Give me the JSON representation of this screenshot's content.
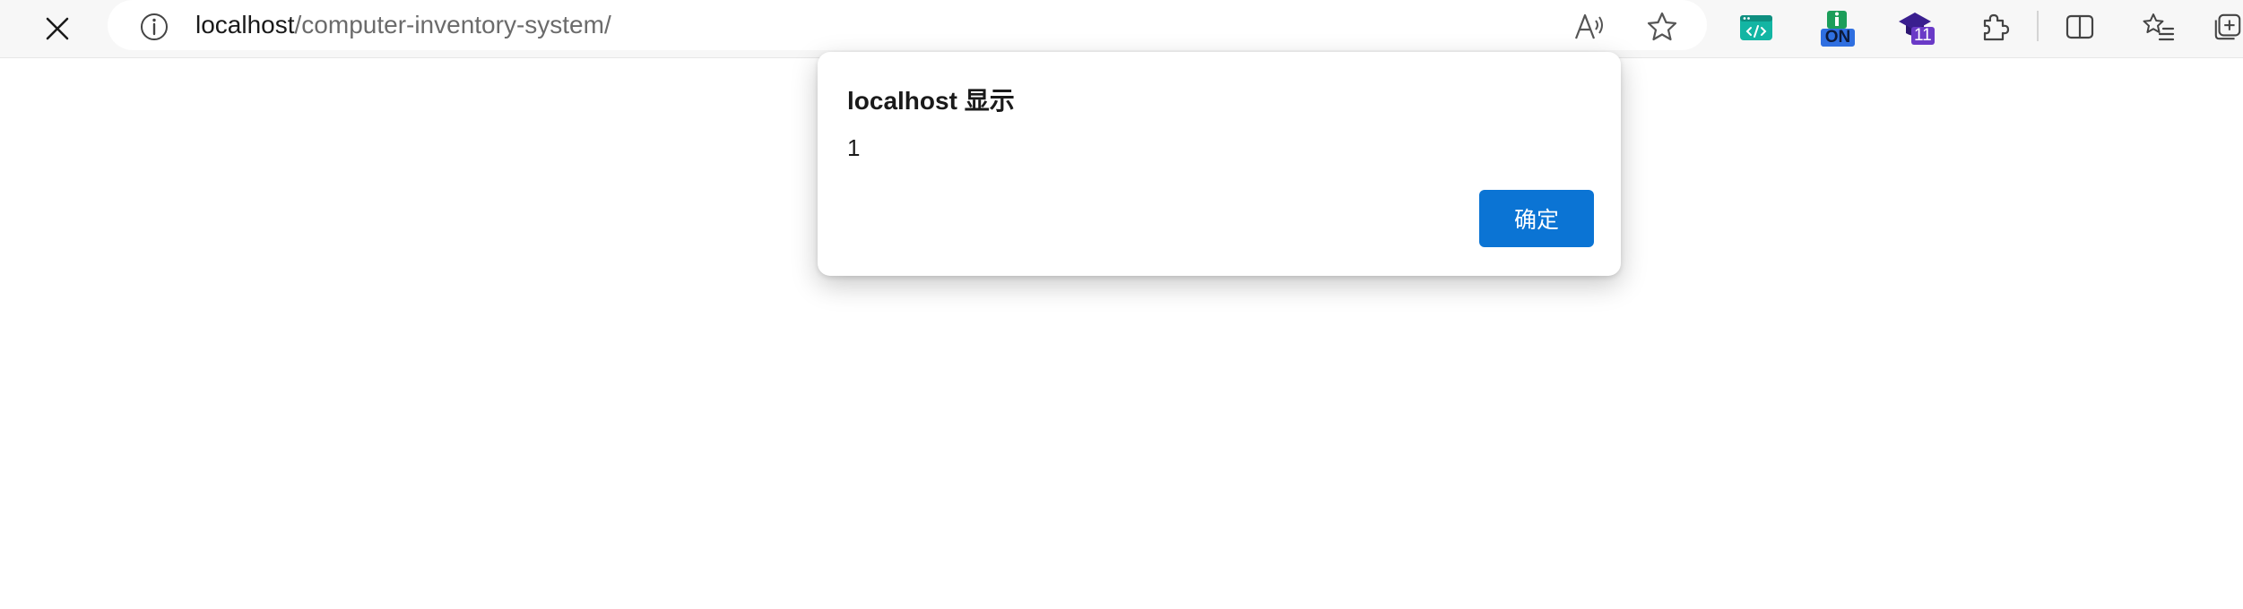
{
  "browser": {
    "url_host": "localhost",
    "url_path": "/computer-inventory-system/",
    "extensions": [
      {
        "name": "code-extension",
        "badge": ""
      },
      {
        "name": "on-extension",
        "badge": "ON"
      },
      {
        "name": "graduation-extension",
        "badge": "11"
      }
    ]
  },
  "dialog": {
    "title": "localhost 显示",
    "message": "1",
    "ok_label": "确定"
  },
  "colors": {
    "accent": "#0b74d4",
    "ext_teal": "#13b5a3",
    "ext_on": "#2f6fe0",
    "ext_purple": "#6a3ac7"
  }
}
